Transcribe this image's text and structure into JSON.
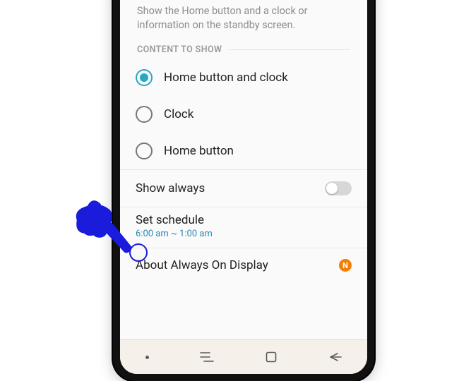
{
  "description": "Show the Home button and a clock or information on the standby screen.",
  "section_header": "CONTENT TO SHOW",
  "content_options": [
    {
      "label": "Home button and clock",
      "selected": true
    },
    {
      "label": "Clock",
      "selected": false
    },
    {
      "label": "Home button",
      "selected": false
    }
  ],
  "show_always": {
    "label": "Show always",
    "enabled": false
  },
  "set_schedule": {
    "label": "Set schedule",
    "value": "6:00 am ~ 1:00 am"
  },
  "about": {
    "label": "About Always On Display",
    "badge": "N"
  }
}
